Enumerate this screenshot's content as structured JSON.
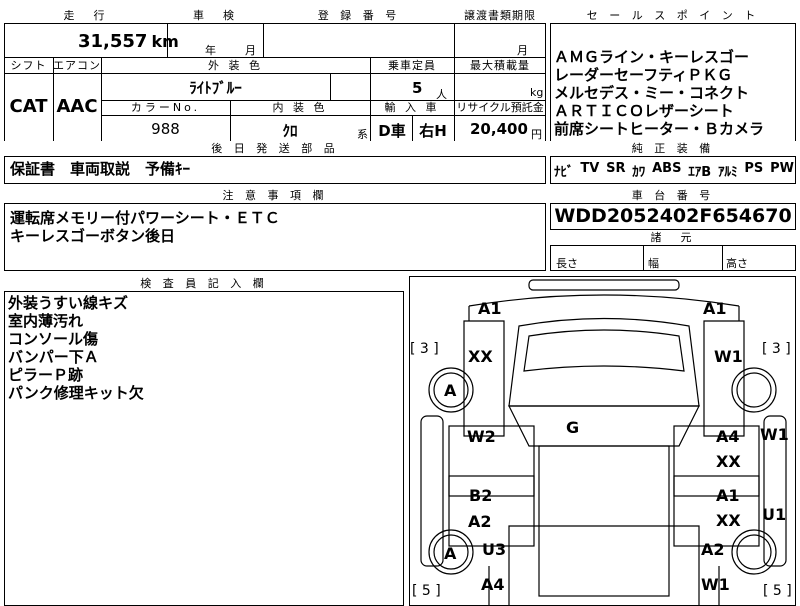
{
  "top": {
    "mileage_header": "走　行",
    "inspection_header": "車　検",
    "registration_header": "登 録 番 号",
    "transfer_header": "譲渡書類期限",
    "mileage_value": "31,557",
    "mileage_unit": "km",
    "inspection_year_unit": "年",
    "inspection_month_unit": "月",
    "transfer_month_unit": "月",
    "shift_header": "シフト",
    "ac_header": "エアコン",
    "exterior_color_header": "外 装 色",
    "capacity_header": "乗車定員",
    "max_load_header": "最大積載量",
    "shift_value": "CAT",
    "ac_value": "AAC",
    "exterior_color_value": "ﾗｲﾄﾌﾞﾙｰ",
    "capacity_value": "5",
    "capacity_unit": "人",
    "load_unit": "kg",
    "color_no_header": "カラーNo.",
    "interior_color_header": "内 装 色",
    "import_header": "輸 入 車",
    "recycle_header": "リサイクル預託金",
    "color_no_value": "988",
    "interior_color_value": "ｸﾛ",
    "interior_suffix": "系",
    "import_value": "D車",
    "steering_value": "右H",
    "recycle_value": "20,400",
    "recycle_unit": "円"
  },
  "sales_points": {
    "header": "セ ー ル ス ポ イ ン ト",
    "lines": [
      "ＡＭＧライン・キーレスゴー",
      "レーダーセーフティＰＫＧ",
      "メルセデス・ミー・コネクト",
      "ＡＲＴＩＣＯレザーシート",
      "前席シートヒーター・Ｂカメラ"
    ]
  },
  "later_parts": {
    "header": "後 日 発 送 部 品",
    "value": "保証書　車両取説　予備ｷｰ"
  },
  "equipment": {
    "header": "純 正 装 備",
    "items": [
      "ﾅﾋﾞ",
      "TV",
      "SR",
      "ｶﾜ",
      "ABS",
      "ｴｱB",
      "ｱﾙﾐ",
      "PS",
      "PW"
    ]
  },
  "notes": {
    "header": "注 意 事 項 欄",
    "lines": [
      "運転席メモリー付パワーシート・ＥＴＣ",
      "キーレスゴーボタン後日"
    ]
  },
  "chassis": {
    "header": "車 台 番 号",
    "value": "WDD2052402F654670"
  },
  "dimensions": {
    "header": "諸　元",
    "length": "長さ",
    "width": "幅",
    "height": "高さ"
  },
  "inspector": {
    "header": "検 査 員 記 入 欄",
    "lines": [
      "外装うすい線キズ",
      "室内薄汚れ",
      "コンソール傷",
      "バンパー下Ａ",
      "ピラーＰ跡",
      "パンク修理キット欠"
    ]
  },
  "damage_map": {
    "front_left_bumper": "A1",
    "front_right_bumper": "A1",
    "left_tire_count": "[ 3 ]",
    "right_tire_count": "[ 3 ]",
    "front_left_fender": "XX",
    "front_right_fender": "W1",
    "front_left_wheel": "A",
    "roof": "G",
    "left_front_door": "W2",
    "right_front_door": "A4",
    "right_front_door2": "XX",
    "right_side_sill": "W1",
    "left_rear_door": "B2",
    "left_rear_door2": "A2",
    "right_rear_door": "A1",
    "right_rear_door2": "XX",
    "right_rear_sill": "U1",
    "rear_left_wheel": "A",
    "rear_left_fender": "U3",
    "rear_right_fender": "A2",
    "rear_left_bumper": "A4",
    "rear_right_bumper": "W1",
    "left_bottom_count": "[ 5 ]",
    "right_bottom_count": "[ 5 ]"
  }
}
